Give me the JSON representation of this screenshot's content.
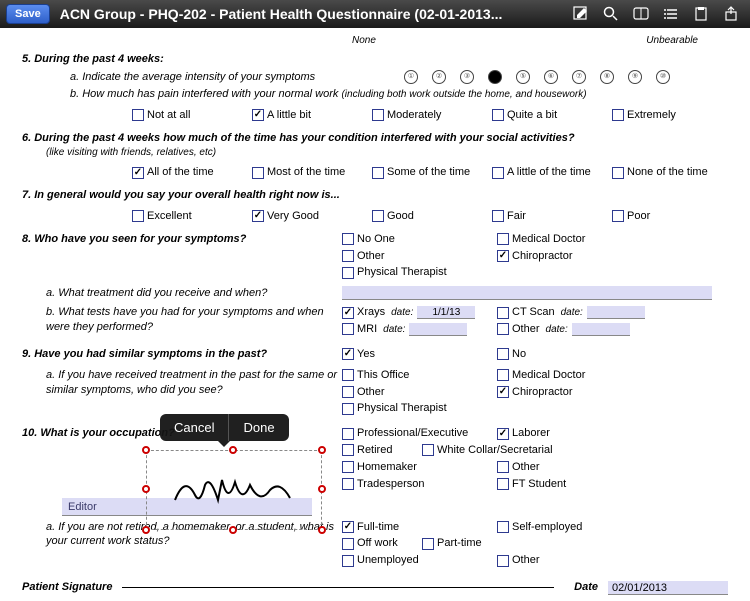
{
  "nav": {
    "save": "Save",
    "title": "ACN Group - PHQ-202 - Patient Health Questionnaire (02-01-2013..."
  },
  "scale": {
    "none": "None",
    "unbearable": "Unbearable"
  },
  "q5": {
    "head": "5. During the past 4 weeks:",
    "a": "a. Indicate the average intensity of your symptoms",
    "b": "b. How much has pain interfered with your normal work ",
    "bparen": "(including both work outside the home, and housework)",
    "opts": [
      "Not at all",
      "A little bit",
      "Moderately",
      "Quite a bit",
      "Extremely"
    ]
  },
  "q6": {
    "head": "6. During the past 4 weeks how much of the time has your condition interfered with your social activities?",
    "paren": "(like visiting with friends, relatives, etc)",
    "opts": [
      "All of the time",
      "Most of the time",
      "Some of the time",
      "A little of the time",
      "None of the time"
    ]
  },
  "q7": {
    "head": "7. In general would you say your overall health right now is...",
    "opts": [
      "Excellent",
      "Very Good",
      "Good",
      "Fair",
      "Poor"
    ]
  },
  "q8": {
    "head": "8. Who have you seen for your symptoms?",
    "opts1": [
      "No One",
      "Medical Doctor",
      "Other",
      "Chiropractor",
      "Physical Therapist"
    ],
    "a": "a. What treatment did you receive and when?",
    "b": "b. What tests have you had for your symptoms and when were they performed?",
    "tests": {
      "xrays": "Xrays",
      "ct": "CT Scan",
      "mri": "MRI",
      "other": "Other",
      "date": "date:",
      "d1": "1/1/13"
    }
  },
  "q9": {
    "head": "9. Have you had similar symptoms in the past?",
    "yes": "Yes",
    "no": "No",
    "a": "a. If you have received treatment in the past for the same or similar symptoms, who did you see?",
    "opts": [
      "This Office",
      "Medical Doctor",
      "Other",
      "Chiropractor",
      "Physical Therapist"
    ]
  },
  "q10": {
    "head": "10. What is your occupation?",
    "val": "Editor",
    "opts": [
      "Professional/Executive",
      "Laborer",
      "Retired",
      "White Collar/Secretarial",
      "Homemaker",
      "Other",
      "Tradesperson",
      "FT Student"
    ],
    "a": "a. If you are not retired, a homemaker, or a student, what is your current work status?",
    "status": [
      "Full-time",
      "Self-employed",
      "Off work",
      "Part-time",
      "Unemployed",
      "Other"
    ]
  },
  "sig": {
    "patient": "Patient Signature",
    "date": "Date",
    "dval": "02/01/2013"
  },
  "pop": {
    "cancel": "Cancel",
    "done": "Done"
  }
}
